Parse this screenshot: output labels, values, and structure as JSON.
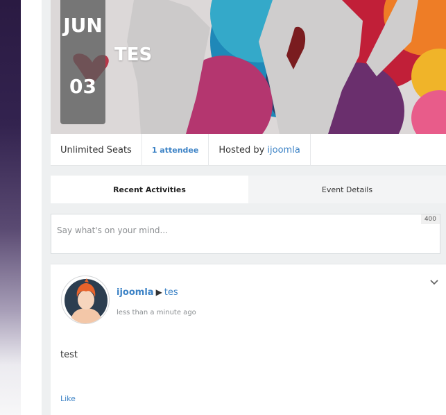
{
  "event": {
    "month": "JUN",
    "day": "03",
    "title": "TES"
  },
  "meta": {
    "seats": "Unlimited Seats",
    "attendees": "1 attendee",
    "hosted_by_label": "Hosted by",
    "host": "ijoomla"
  },
  "tabs": [
    {
      "label": "Recent Activities",
      "active": true
    },
    {
      "label": "Event Details",
      "active": false
    }
  ],
  "composer": {
    "placeholder": "Say what's on your mind...",
    "char_count": "400"
  },
  "activity": {
    "actor": "ijoomla",
    "target": "tes",
    "time": "less than a minute ago",
    "text": "test",
    "like_label": "Like"
  },
  "colors": {
    "accent": "#3d83c6",
    "background": "#eef0f1"
  },
  "icons": [
    "triangle-right-icon",
    "chevron-down-icon",
    "avatar-icon"
  ]
}
